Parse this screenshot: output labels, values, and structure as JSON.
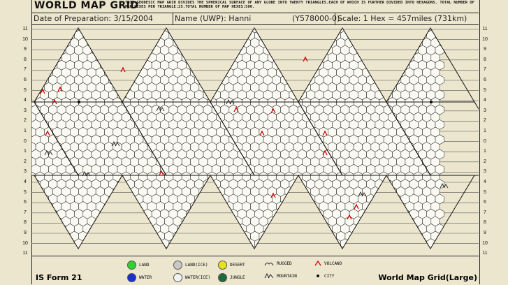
{
  "header": {
    "title": "WORLD MAP GRID",
    "description": "THIS GEODESIC MAP GRID DIVIDES THE SPHERICAL SURFACE OF ANY GLOBE INTO TWENTY TRIANGLES.EACH OF WHICH IS FURTHER DIVIDED INTO HEXAGONS. TOTAL NUMBER OF MAP HEXES PER TRIANGLE:25.TOTAL NUMBER OF MAP HEXES:500."
  },
  "info": {
    "date": "Date of Preparation: 3/15/2004",
    "name": "Name (UWP): Hanni",
    "uwp": "(Y578000-0)",
    "scale": "Scale: 1 Hex = 457miles (731km)"
  },
  "row_labels": [
    "11",
    "10",
    "9",
    "8",
    "7",
    "6",
    "5",
    "4",
    "3",
    "2",
    "1",
    "0",
    "1",
    "2",
    "3",
    "4",
    "5",
    "6",
    "7",
    "8",
    "9",
    "10",
    "11"
  ],
  "legend": {
    "form": "IS Form 21",
    "footer_title": "World Map Grid(Large)",
    "items": [
      {
        "label": "LAND",
        "color": "#2fd12f"
      },
      {
        "label": "WATER",
        "color": "#1a2fd0"
      },
      {
        "label": "LAND(ICE)",
        "color": "#c8c8c8"
      },
      {
        "label": "WATER(ICE)",
        "color": "#f2f2f2"
      },
      {
        "label": "DESERT",
        "color": "#e8e020"
      },
      {
        "label": "JUNGLE",
        "color": "#1e6a3a"
      },
      {
        "label": "RUGGED",
        "icon": "rugged-icon"
      },
      {
        "label": "MOUNTAIN",
        "icon": "mountain-icon"
      },
      {
        "label": "VOLCANO",
        "icon": "volcano-icon"
      },
      {
        "label": "CITY",
        "icon": "city-icon"
      }
    ]
  }
}
